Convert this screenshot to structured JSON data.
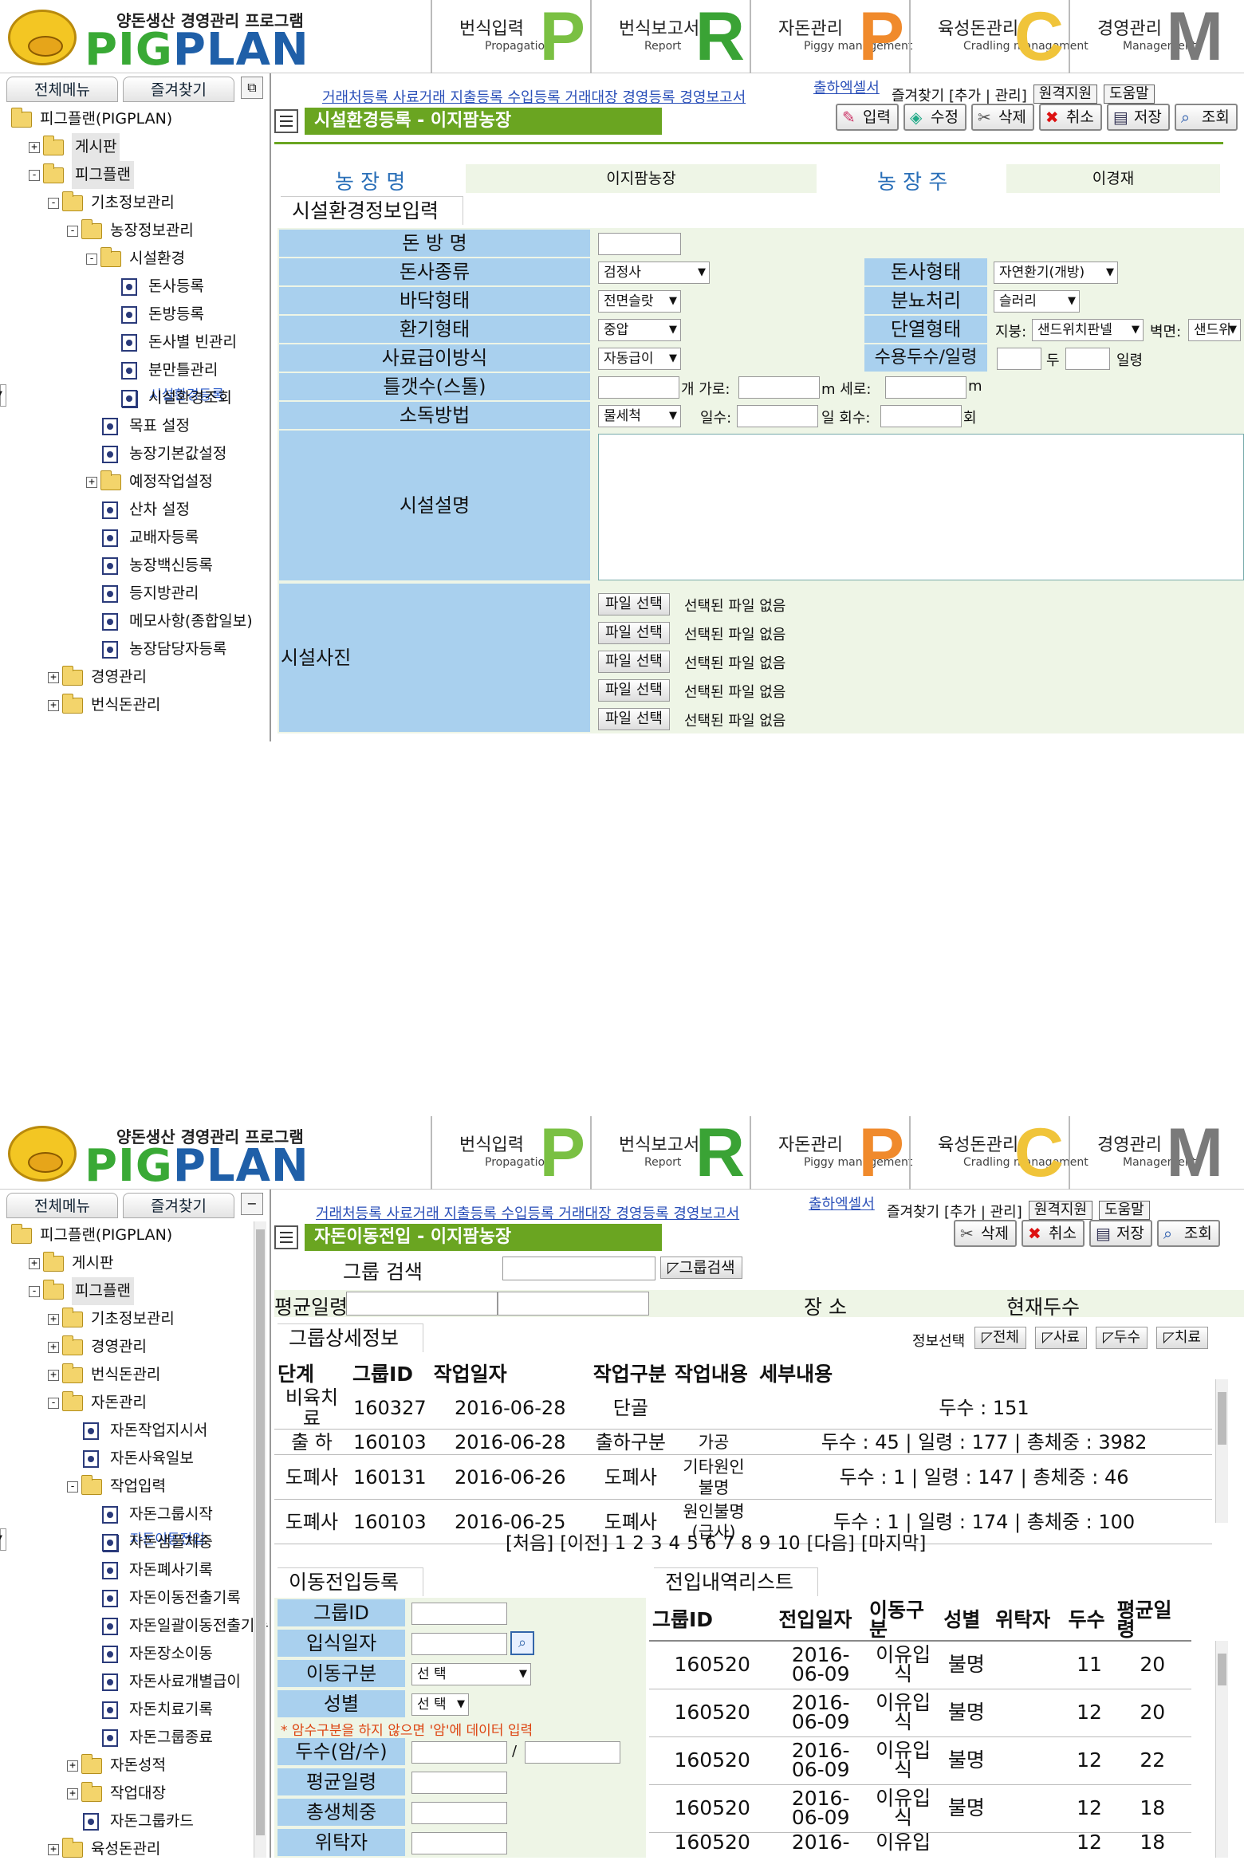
{
  "app": {
    "logo_sub": "양돈생산 경영관리 프로그램",
    "logo_name_a": "PIG",
    "logo_name_b": "PLAN",
    "topnav": [
      {
        "label": "번식입력",
        "sub": "Propagation",
        "letter": "P",
        "color": "#7ac043"
      },
      {
        "label": "번식보고서",
        "sub": "Report",
        "letter": "R",
        "color": "#3aa335"
      },
      {
        "label": "자돈관리",
        "sub": "Piggy management",
        "letter": "P",
        "color": "#f08a2c"
      },
      {
        "label": "육성돈관리",
        "sub": "Cradling management",
        "letter": "C",
        "color": "#f0c43a"
      },
      {
        "label": "경영관리",
        "sub": "Management",
        "letter": "M",
        "color": "#7a7a7a"
      }
    ],
    "left_tabs": [
      "전체메뉴",
      "즐겨찾기"
    ],
    "sub_links": "거래처등록 사료거래 지출등록 수입등록 거래대장 경영등록 경영보고서",
    "sub_links2": "출하엑셀서",
    "tools": [
      "즐겨찾기 [추가 | 관리]",
      "원격지원",
      "도움말"
    ]
  },
  "shot1": {
    "tree": [
      {
        "label": "피그플랜(PIGPLAN)",
        "level": 0,
        "type": "folder"
      },
      {
        "label": "게시판",
        "level": 1,
        "type": "folder",
        "tog": "+",
        "hl": true
      },
      {
        "label": "피그플랜",
        "level": 1,
        "type": "folder",
        "tog": "-",
        "hl": true
      },
      {
        "label": "기초정보관리",
        "level": 2,
        "type": "folder",
        "tog": "-"
      },
      {
        "label": "농장정보관리",
        "level": 3,
        "type": "folder",
        "tog": "-"
      },
      {
        "label": "시설환경",
        "level": 4,
        "type": "folder",
        "tog": "-"
      },
      {
        "label": "돈사등록",
        "level": 5,
        "type": "doc"
      },
      {
        "label": "돈방등록",
        "level": 5,
        "type": "doc"
      },
      {
        "label": "돈사별 빈관리",
        "level": 5,
        "type": "doc"
      },
      {
        "label": "분만틀관리",
        "level": 5,
        "type": "doc"
      },
      {
        "label": "시설환경등록",
        "level": 5,
        "type": "doc",
        "sel": true
      },
      {
        "label": "시설환경조회",
        "level": 5,
        "type": "doc"
      },
      {
        "label": "목표 설정",
        "level": 4,
        "type": "doc"
      },
      {
        "label": "농장기본값설정",
        "level": 4,
        "type": "doc"
      },
      {
        "label": "예정작업설정",
        "level": 4,
        "type": "folder",
        "tog": "+"
      },
      {
        "label": "산차 설정",
        "level": 4,
        "type": "doc"
      },
      {
        "label": "교배자등록",
        "level": 4,
        "type": "doc"
      },
      {
        "label": "농장백신등록",
        "level": 4,
        "type": "doc"
      },
      {
        "label": "등지방관리",
        "level": 4,
        "type": "doc"
      },
      {
        "label": "메모사항(종합일보)",
        "level": 4,
        "type": "doc"
      },
      {
        "label": "농장담당자등록",
        "level": 4,
        "type": "doc"
      },
      {
        "label": "경영관리",
        "level": 2,
        "type": "folder",
        "tog": "+"
      },
      {
        "label": "번식돈관리",
        "level": 2,
        "type": "folder",
        "tog": "+"
      }
    ],
    "title": "시설환경등록 - 이지팜농장",
    "buttons": [
      "입력",
      "수정",
      "삭제",
      "취소",
      "저장",
      "조회"
    ],
    "farm_label": "농 장 명",
    "farm_value": "이지팜농장",
    "owner_label": "농 장 주",
    "owner_value": "이경재",
    "section": "시설환경정보입력",
    "labels": {
      "room": "돈 방 명",
      "house_type": "돈사종류",
      "floor": "바닥형태",
      "vent": "환기형태",
      "feed": "사료급이방식",
      "stall": "틀갯수(스톨)",
      "disinfect": "소독방법",
      "desc": "시설설명",
      "photo": "시설사진",
      "house_form": "돈사형태",
      "manure": "분뇨처리",
      "insul": "단열형태",
      "capacity": "수용두수/일령"
    },
    "values": {
      "house_type": "검정사",
      "floor": "전면슬랏",
      "vent": "중압",
      "feed": "자동급이",
      "disinfect": "물세척",
      "house_form": "자연환기(개방)",
      "manure": "슬러리",
      "roof_label": "지붕:",
      "roof": "샌드위치판넬",
      "wall_label": "벽면:",
      "wall": "샌드위",
      "head": "두",
      "age": "일령",
      "count_unit": "개 가로:",
      "m1": "m  세로:",
      "m2": "m",
      "days_label": "일수:",
      "day_unit": "일 회수:",
      "times_unit": "회"
    },
    "file_button": "파일 선택",
    "file_none": "선택된 파일 없음"
  },
  "shot2": {
    "tree": [
      {
        "label": "피그플랜(PIGPLAN)",
        "level": 0,
        "type": "folder"
      },
      {
        "label": "게시판",
        "level": 1,
        "type": "folder",
        "tog": "+"
      },
      {
        "label": "피그플랜",
        "level": 1,
        "type": "folder",
        "tog": "-",
        "hl": true
      },
      {
        "label": "기초정보관리",
        "level": 2,
        "type": "folder",
        "tog": "+"
      },
      {
        "label": "경영관리",
        "level": 2,
        "type": "folder",
        "tog": "+"
      },
      {
        "label": "번식돈관리",
        "level": 2,
        "type": "folder",
        "tog": "+"
      },
      {
        "label": "자돈관리",
        "level": 2,
        "type": "folder",
        "tog": "-"
      },
      {
        "label": "자돈작업지시서",
        "level": 3,
        "type": "doc"
      },
      {
        "label": "자돈사육일보",
        "level": 3,
        "type": "doc"
      },
      {
        "label": "작업입력",
        "level": 3,
        "type": "folder",
        "tog": "-"
      },
      {
        "label": "자돈그룹시작",
        "level": 4,
        "type": "doc"
      },
      {
        "label": "자돈이동전입",
        "level": 4,
        "type": "doc",
        "sel": true
      },
      {
        "label": "자돈샘플체중",
        "level": 4,
        "type": "doc"
      },
      {
        "label": "자돈폐사기록",
        "level": 4,
        "type": "doc"
      },
      {
        "label": "자돈이동전출기록",
        "level": 4,
        "type": "doc"
      },
      {
        "label": "자돈일괄이동전출기록",
        "level": 4,
        "type": "doc"
      },
      {
        "label": "자돈장소이동",
        "level": 4,
        "type": "doc"
      },
      {
        "label": "자돈사료개별급이",
        "level": 4,
        "type": "doc"
      },
      {
        "label": "자돈치료기록",
        "level": 4,
        "type": "doc"
      },
      {
        "label": "자돈그룹종료",
        "level": 4,
        "type": "doc"
      },
      {
        "label": "자돈성적",
        "level": 3,
        "type": "folder",
        "tog": "+"
      },
      {
        "label": "작업대장",
        "level": 3,
        "type": "folder",
        "tog": "+"
      },
      {
        "label": "자돈그룹카드",
        "level": 3,
        "type": "doc"
      },
      {
        "label": "육성돈관리",
        "level": 2,
        "type": "folder",
        "tog": "+"
      }
    ],
    "title": "자돈이동전입 - 이지팜농장",
    "buttons": [
      "삭제",
      "취소",
      "저장",
      "조회"
    ],
    "group_search_label": "그룹 검색",
    "group_search_button": "그룹검색",
    "avg_age_label": "평균일령",
    "place_label": "장 소",
    "current_label": "현재두수",
    "detail_section": "그룹상세정보",
    "info_select_label": "정보선택",
    "info_buttons": [
      "전체",
      "사료",
      "두수",
      "치료"
    ],
    "detail_headers": [
      "단계",
      "그룹ID",
      "작업일자",
      "작업구분",
      "작업내용",
      "세부내용"
    ],
    "detail_rows": [
      [
        "비육치료",
        "160327",
        "2016-06-28",
        "단골",
        "",
        "두수 : 151"
      ],
      [
        "출 하",
        "160103",
        "2016-06-28",
        "출하구분",
        "가공",
        "두수 : 45 | 일령 : 177  | 총체중 :  3982"
      ],
      [
        "도폐사",
        "160131",
        "2016-06-26",
        "도폐사",
        "기타원인 불명",
        "두수 : 1 | 일령 : 147  | 총체중 :  46"
      ],
      [
        "도폐사",
        "160103",
        "2016-06-25",
        "도폐사",
        "원인불명 (급사)",
        "두수 : 1 | 일령 : 174  | 총체중 :  100"
      ]
    ],
    "pager": [
      "[처음]",
      "[이전]",
      "1",
      "2",
      "3",
      "4",
      "5",
      "6",
      "7",
      "8",
      "9",
      "10",
      "[다음]",
      "[마지막]"
    ],
    "move_section": "이동전입등록",
    "move_labels": [
      "그룹ID",
      "입식일자",
      "이동구분",
      "성별",
      "두수(암/수)",
      "평균일령",
      "총생체중",
      "위탁자"
    ],
    "move_select": "선 택",
    "sex_select": "선 택",
    "warning": "* 암수구분을 하지 않으면 '암'에 데이터 입력",
    "slash": "/",
    "list_section": "전입내역리스트",
    "list_headers": [
      "그룹ID",
      "전입일자",
      "이동구분",
      "성별",
      "위탁자",
      "두수",
      "평균일령"
    ],
    "list_rows": [
      [
        "160520",
        "2016-06-09",
        "이유입식",
        "불명",
        "",
        "11",
        "20"
      ],
      [
        "160520",
        "2016-06-09",
        "이유입식",
        "불명",
        "",
        "12",
        "20"
      ],
      [
        "160520",
        "2016-06-09",
        "이유입식",
        "불명",
        "",
        "12",
        "22"
      ],
      [
        "160520",
        "2016-06-09",
        "이유입식",
        "불명",
        "",
        "12",
        "18"
      ]
    ],
    "list_partial": [
      "160520",
      "2016-",
      "이유입",
      "",
      "",
      "12",
      "18"
    ]
  }
}
